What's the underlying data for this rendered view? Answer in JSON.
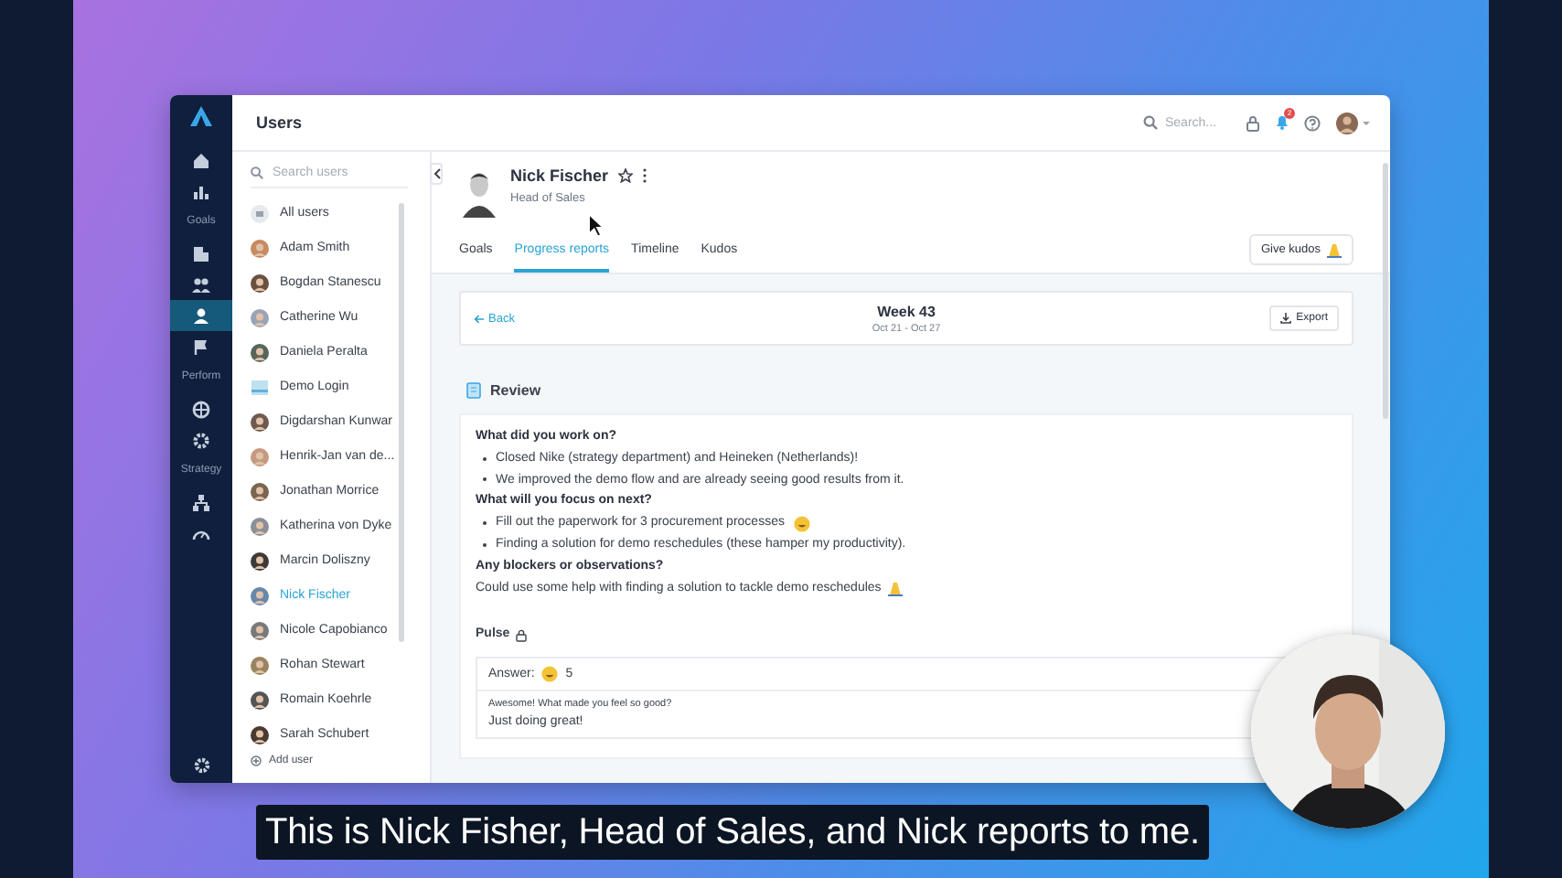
{
  "app": {
    "title": "Users"
  },
  "nav": {
    "items": [
      {
        "kind": "button",
        "selected": false
      },
      {
        "kind": "button",
        "selected": false
      },
      {
        "kind": "section",
        "label": "Goals"
      },
      {
        "kind": "button",
        "selected": false
      },
      {
        "kind": "button",
        "selected": false
      },
      {
        "kind": "button",
        "selected": true
      },
      {
        "kind": "button",
        "selected": false
      },
      {
        "kind": "section",
        "label": "Perform"
      },
      {
        "kind": "button",
        "selected": false
      },
      {
        "kind": "button",
        "selected": false
      },
      {
        "kind": "section",
        "label": "Strategy"
      },
      {
        "kind": "button",
        "selected": false
      },
      {
        "kind": "button",
        "selected": false
      }
    ]
  },
  "topbar": {
    "search": {
      "placeholder": "Search..."
    },
    "notification_count": "2"
  },
  "users": {
    "search": {
      "placeholder": "Search users"
    },
    "items": [
      {
        "name": "All users",
        "kind": "all",
        "selected": false
      },
      {
        "name": "Adam Smith",
        "kind": "user",
        "selected": false
      },
      {
        "name": "Bogdan Stanescu",
        "kind": "user",
        "selected": false
      },
      {
        "name": "Catherine Wu",
        "kind": "user",
        "selected": false
      },
      {
        "name": "Daniela Peralta",
        "kind": "user",
        "selected": false
      },
      {
        "name": "Demo Login",
        "kind": "demo",
        "selected": false
      },
      {
        "name": "Digdarshan Kunwar",
        "kind": "user",
        "selected": false
      },
      {
        "name": "Henrik-Jan van de...",
        "kind": "user",
        "selected": false
      },
      {
        "name": "Jonathan Morrice",
        "kind": "user",
        "selected": false
      },
      {
        "name": "Katherina von Dyke",
        "kind": "user",
        "selected": false
      },
      {
        "name": "Marcin Doliszny",
        "kind": "user",
        "selected": false
      },
      {
        "name": "Nick Fischer",
        "kind": "user",
        "selected": true
      },
      {
        "name": "Nicole Capobianco",
        "kind": "user",
        "selected": false
      },
      {
        "name": "Rohan Stewart",
        "kind": "user",
        "selected": false
      },
      {
        "name": "Romain Koehrle",
        "kind": "user",
        "selected": false
      },
      {
        "name": "Sarah Schubert",
        "kind": "user",
        "selected": false
      }
    ],
    "add_user": "Add user"
  },
  "profile": {
    "name": "Nick Fischer",
    "role": "Head of Sales",
    "tabs": [
      {
        "label": "Goals",
        "selected": false
      },
      {
        "label": "Progress reports",
        "selected": true
      },
      {
        "label": "Timeline",
        "selected": false
      },
      {
        "label": "Kudos",
        "selected": false
      }
    ],
    "give_kudos": "Give kudos"
  },
  "report": {
    "back": "Back",
    "week": "Week 43",
    "range": "Oct 21 - Oct 27",
    "export": "Export"
  },
  "review": {
    "title": "Review",
    "blocks": [
      {
        "kind": "question",
        "text": "What did you work on?"
      },
      {
        "kind": "bullet",
        "text": "Closed Nike (strategy department) and Heineken (Netherlands)!"
      },
      {
        "kind": "bullet",
        "text": "We improved the demo flow and are already seeing good results from it."
      },
      {
        "kind": "question",
        "text": "What will you focus on next?"
      },
      {
        "kind": "bullet",
        "text": "Fill out the paperwork for 3 procurement processes",
        "emoji": true
      },
      {
        "kind": "bullet",
        "text": "Finding a solution for demo reschedules (these hamper my productivity)."
      },
      {
        "kind": "question",
        "text": "Any blockers or observations?"
      },
      {
        "kind": "paragraph",
        "text": "Could use some help with finding a solution to tackle demo reschedules",
        "emoji": true
      }
    ]
  },
  "pulse": {
    "title": "Pulse",
    "answer_label": "Answer:",
    "answer_value": "5",
    "question": "Awesome! What made you feel so good?",
    "reply": "Just doing great!"
  },
  "caption": "This is Nick Fisher, Head of Sales, and Nick reports to me."
}
